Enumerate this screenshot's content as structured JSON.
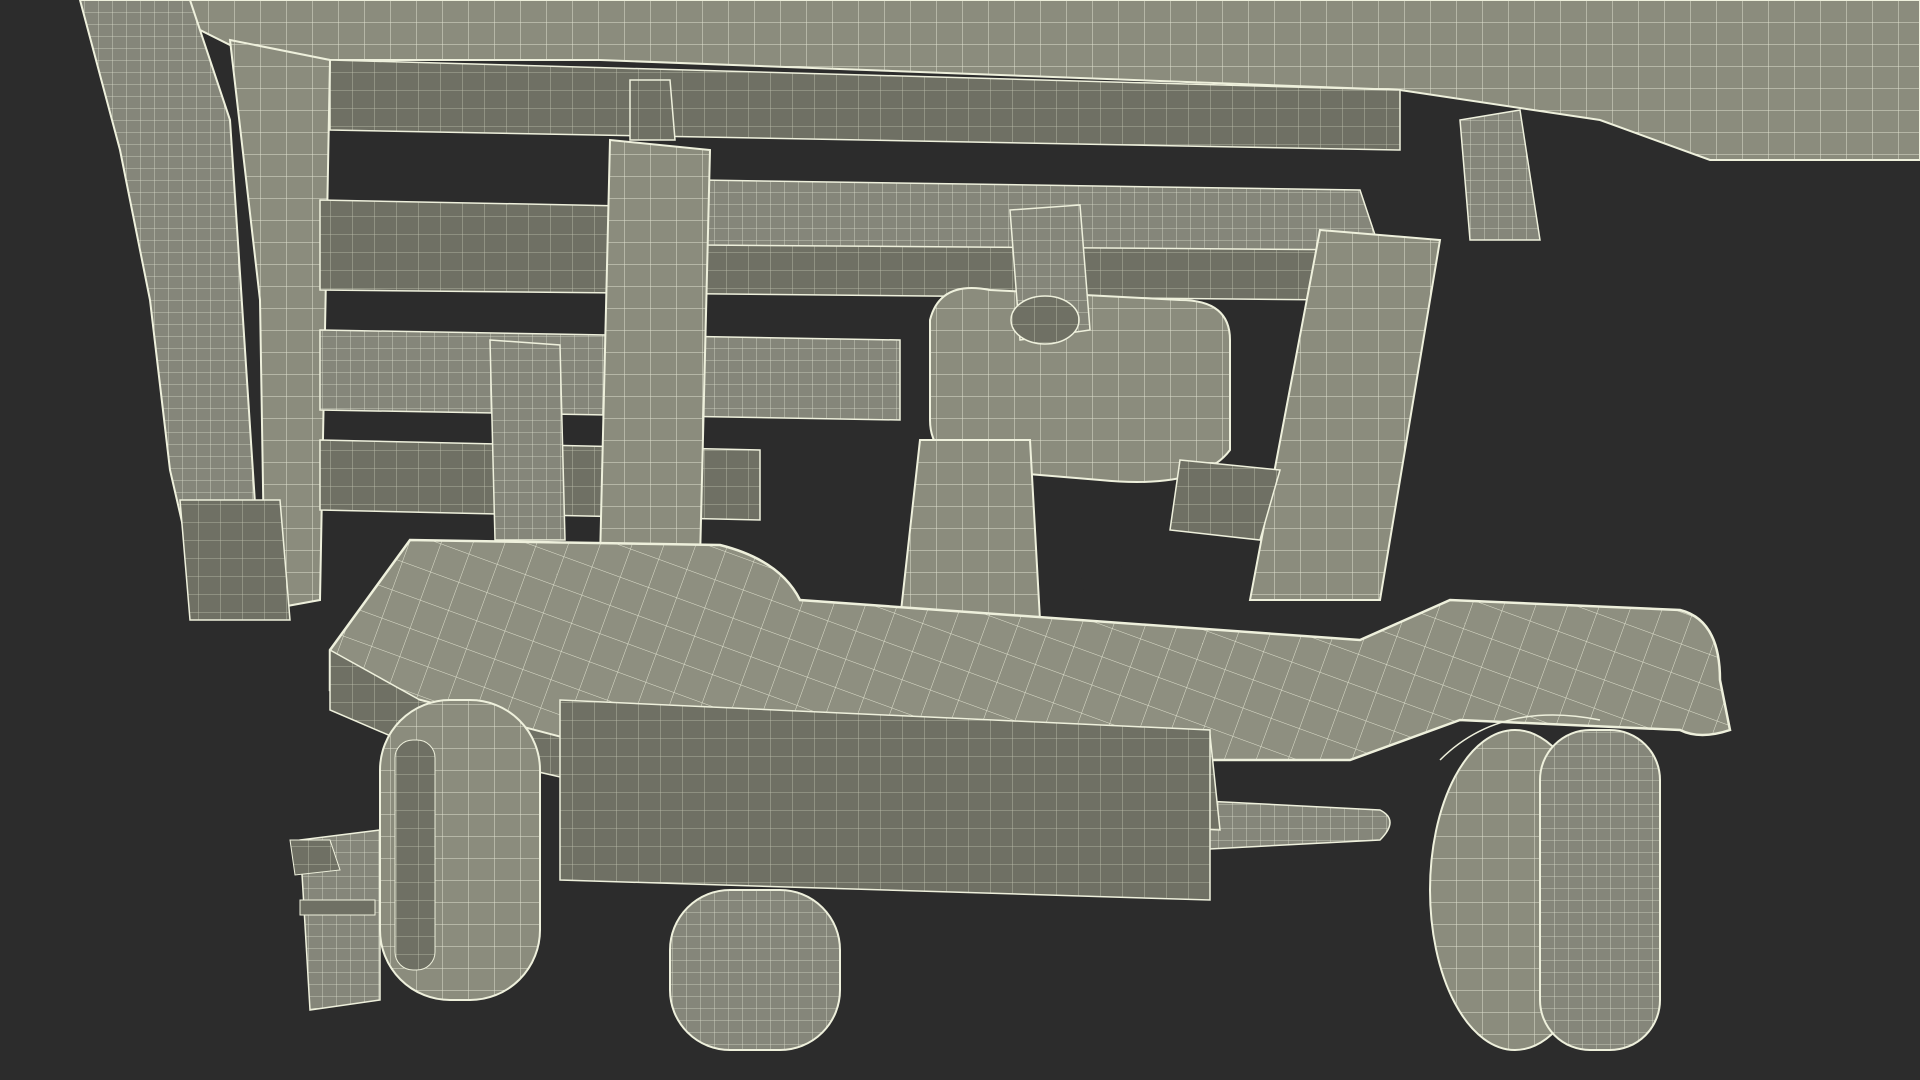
{
  "scene": {
    "subject": "wireframe-render",
    "colors": {
      "background": "#2c2c2c",
      "surface": "#8a8b7c",
      "surface_dark": "#6d6e61",
      "surface_light": "#a3a495",
      "wire": "#eef0dc"
    }
  }
}
